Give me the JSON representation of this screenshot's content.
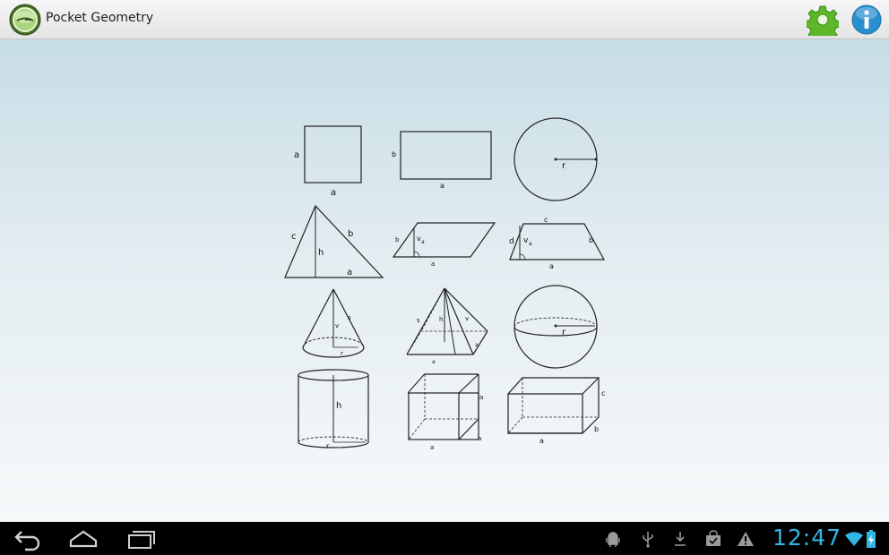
{
  "app": {
    "title": "Pocket Geometry",
    "icons": [
      "app-logo-icon",
      "gear-icon",
      "info-icon"
    ],
    "colors": {
      "gear": "#5cb82a",
      "info": "#2a8fcf",
      "clock": "#33b5e5"
    }
  },
  "shapes": [
    {
      "name": "square",
      "labels": {
        "side": "a",
        "bottom": "a"
      }
    },
    {
      "name": "rectangle",
      "labels": {
        "side": "b",
        "bottom": "a"
      }
    },
    {
      "name": "circle",
      "labels": {
        "radius": "r"
      }
    },
    {
      "name": "triangle",
      "labels": {
        "left": "c",
        "right": "b",
        "height": "h",
        "base": "a"
      }
    },
    {
      "name": "parallelogram",
      "labels": {
        "side": "b",
        "height": "v",
        "height_sub": "a",
        "base": "a"
      }
    },
    {
      "name": "trapezoid",
      "labels": {
        "top": "c",
        "left": "d",
        "height": "v",
        "height_sub": "a",
        "right": "b",
        "base": "a"
      }
    },
    {
      "name": "cone",
      "labels": {
        "slant": "s",
        "height": "v",
        "radius": "r"
      }
    },
    {
      "name": "pyramid",
      "labels": {
        "slant": "s",
        "height": "h",
        "face_height": "v",
        "side": "a",
        "base": "a"
      }
    },
    {
      "name": "sphere",
      "labels": {
        "radius": "r"
      }
    },
    {
      "name": "cylinder",
      "labels": {
        "height": "h",
        "radius": "r"
      }
    },
    {
      "name": "cube",
      "labels": {
        "side": "a",
        "depth": "a",
        "base": "a"
      }
    },
    {
      "name": "rectangular-prism",
      "labels": {
        "height": "c",
        "depth": "b",
        "base": "a"
      }
    }
  ],
  "navigation": [
    "back-icon",
    "home-icon",
    "recent-apps-icon"
  ],
  "status_bar": {
    "icons": [
      "android-debug-icon",
      "usb-icon",
      "download-icon",
      "shopping-bag-icon",
      "warning-icon",
      "wifi-icon",
      "battery-icon"
    ],
    "clock": "12:47"
  }
}
